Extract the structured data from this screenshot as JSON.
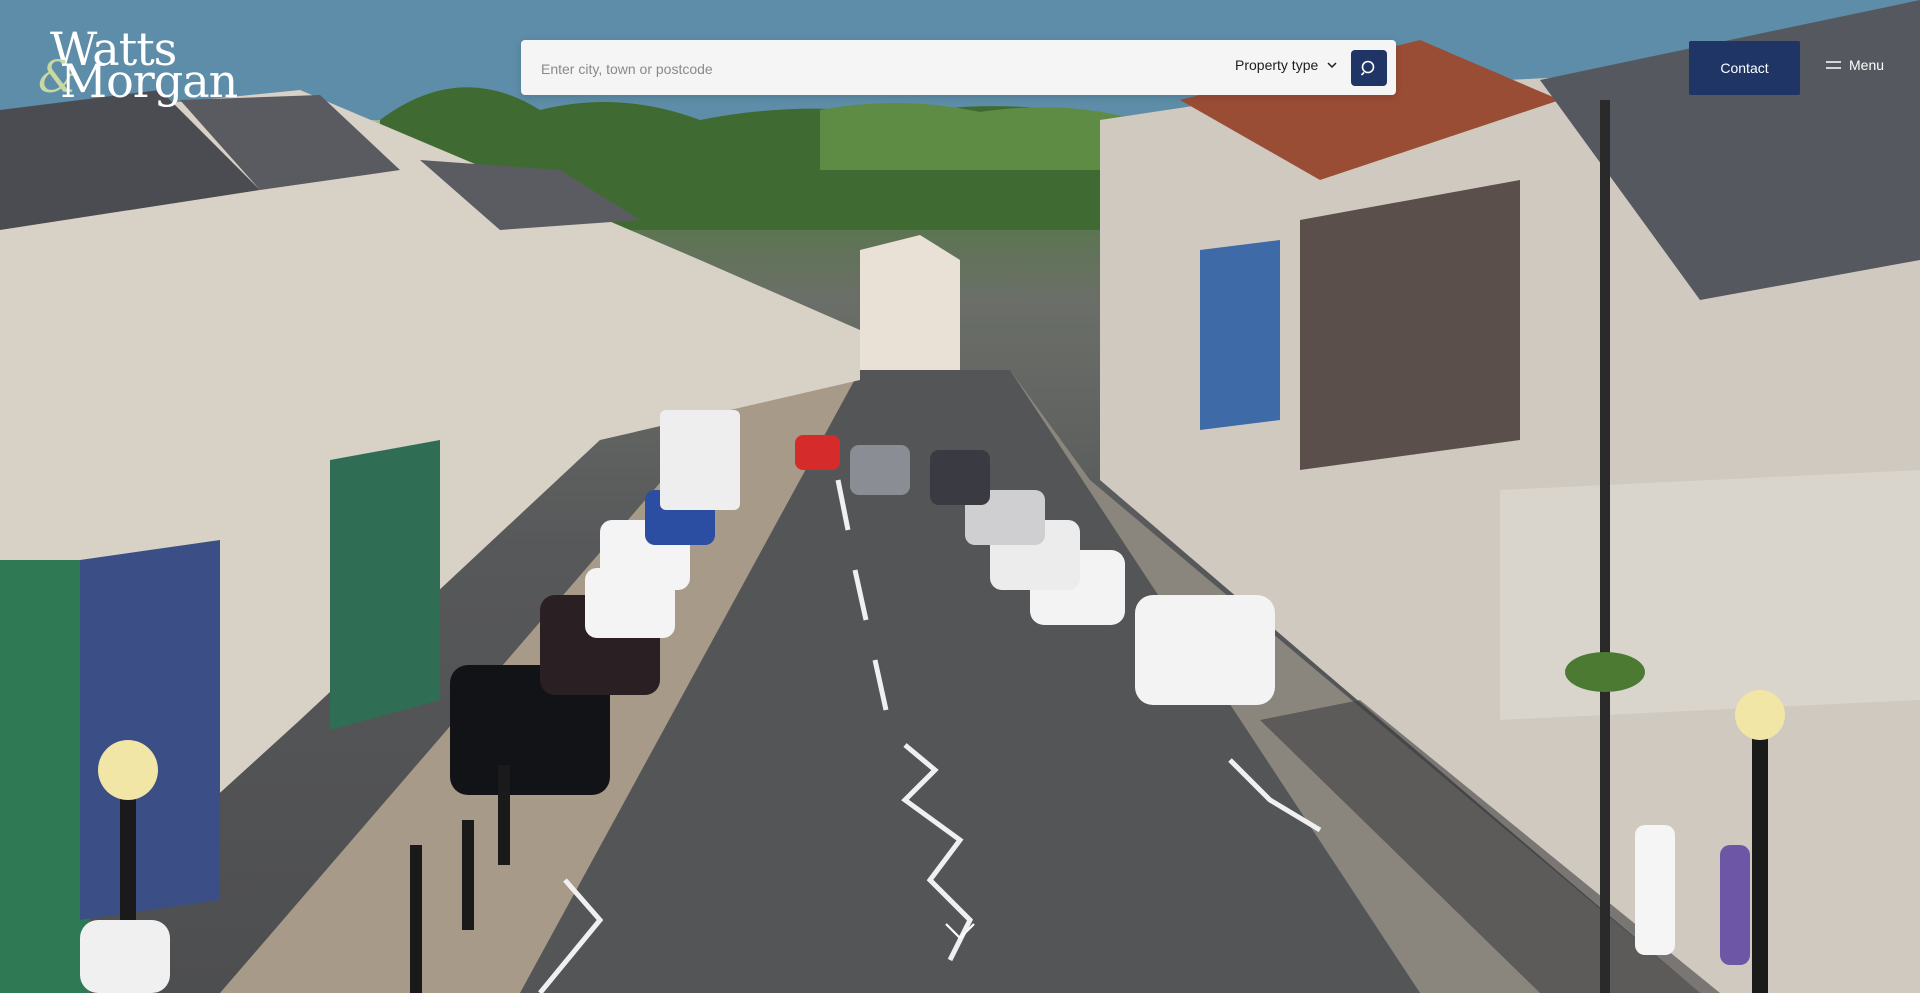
{
  "logo": {
    "line1": "Watts",
    "ampersand": "&",
    "line2": "Morgan"
  },
  "search": {
    "placeholder": "Enter city, town or postcode",
    "value": ""
  },
  "property_type": {
    "label": "Property type"
  },
  "header": {
    "contact_label": "Contact",
    "menu_label": "Menu"
  },
  "colors": {
    "brand_navy": "#1f3566",
    "search_bg": "#f5f5f5",
    "logo_accent": "#c7d9a0"
  },
  "icons": {
    "search": "search-icon",
    "dropdown": "chevron-down-icon",
    "menu": "hamburger-icon",
    "scroll": "chevron-down-icon"
  }
}
